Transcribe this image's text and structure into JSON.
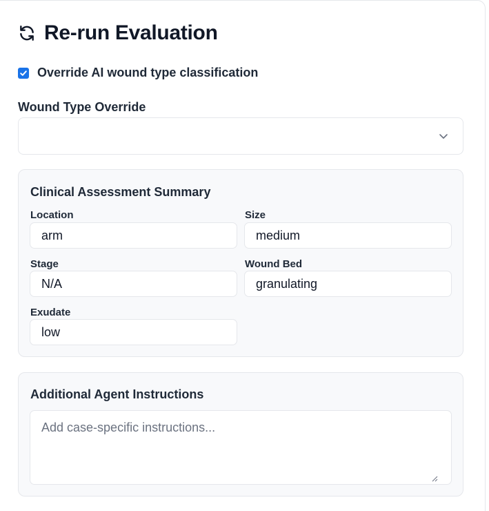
{
  "header": {
    "title": "Re-run Evaluation",
    "icon": "refresh-icon"
  },
  "override": {
    "checked": true,
    "label": "Override AI wound type classification"
  },
  "wound_type": {
    "label": "Wound Type Override",
    "selected_value": ""
  },
  "summary": {
    "title": "Clinical Assessment Summary",
    "fields": [
      {
        "label": "Location",
        "value": "arm"
      },
      {
        "label": "Size",
        "value": "medium"
      },
      {
        "label": "Stage",
        "value": "N/A"
      },
      {
        "label": "Wound Bed",
        "value": "granulating"
      },
      {
        "label": "Exudate",
        "value": "low"
      }
    ]
  },
  "instructions": {
    "title": "Additional Agent Instructions",
    "placeholder": "Add case-specific instructions..."
  },
  "colors": {
    "accent": "#1a73e8",
    "card_bg": "#f8f9fb",
    "border": "#e5e7eb"
  }
}
